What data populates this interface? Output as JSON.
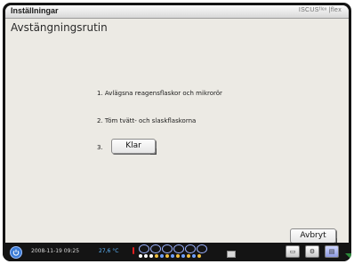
{
  "window": {
    "title": "Inställningar",
    "logo": "ISCUSᶠˡᵉˣ |flex"
  },
  "page": {
    "heading": "Avstängningsrutin"
  },
  "steps": [
    {
      "text": "1. Avlägsna reagensflaskor och mikrorör"
    },
    {
      "text": "2. Töm tvätt- och slaskflaskorna"
    },
    {
      "text": "3."
    }
  ],
  "buttons": {
    "klar": "Klar",
    "avbryt": "Avbryt"
  },
  "statusbar": {
    "datetime": "2008-11-19 09:25",
    "temperature": "27,6 °C",
    "slots_large_count": 6,
    "slots_small_count": 12,
    "colors": {
      "power": "#3b7bd6",
      "temperature_text": "#5fb8ff",
      "thermometer": "#e02020",
      "slot_outline": "#9cb2ff"
    },
    "icons": [
      "power-icon",
      "thermometer-icon",
      "monitor-icon",
      "gear-icon",
      "folder-icon"
    ]
  }
}
